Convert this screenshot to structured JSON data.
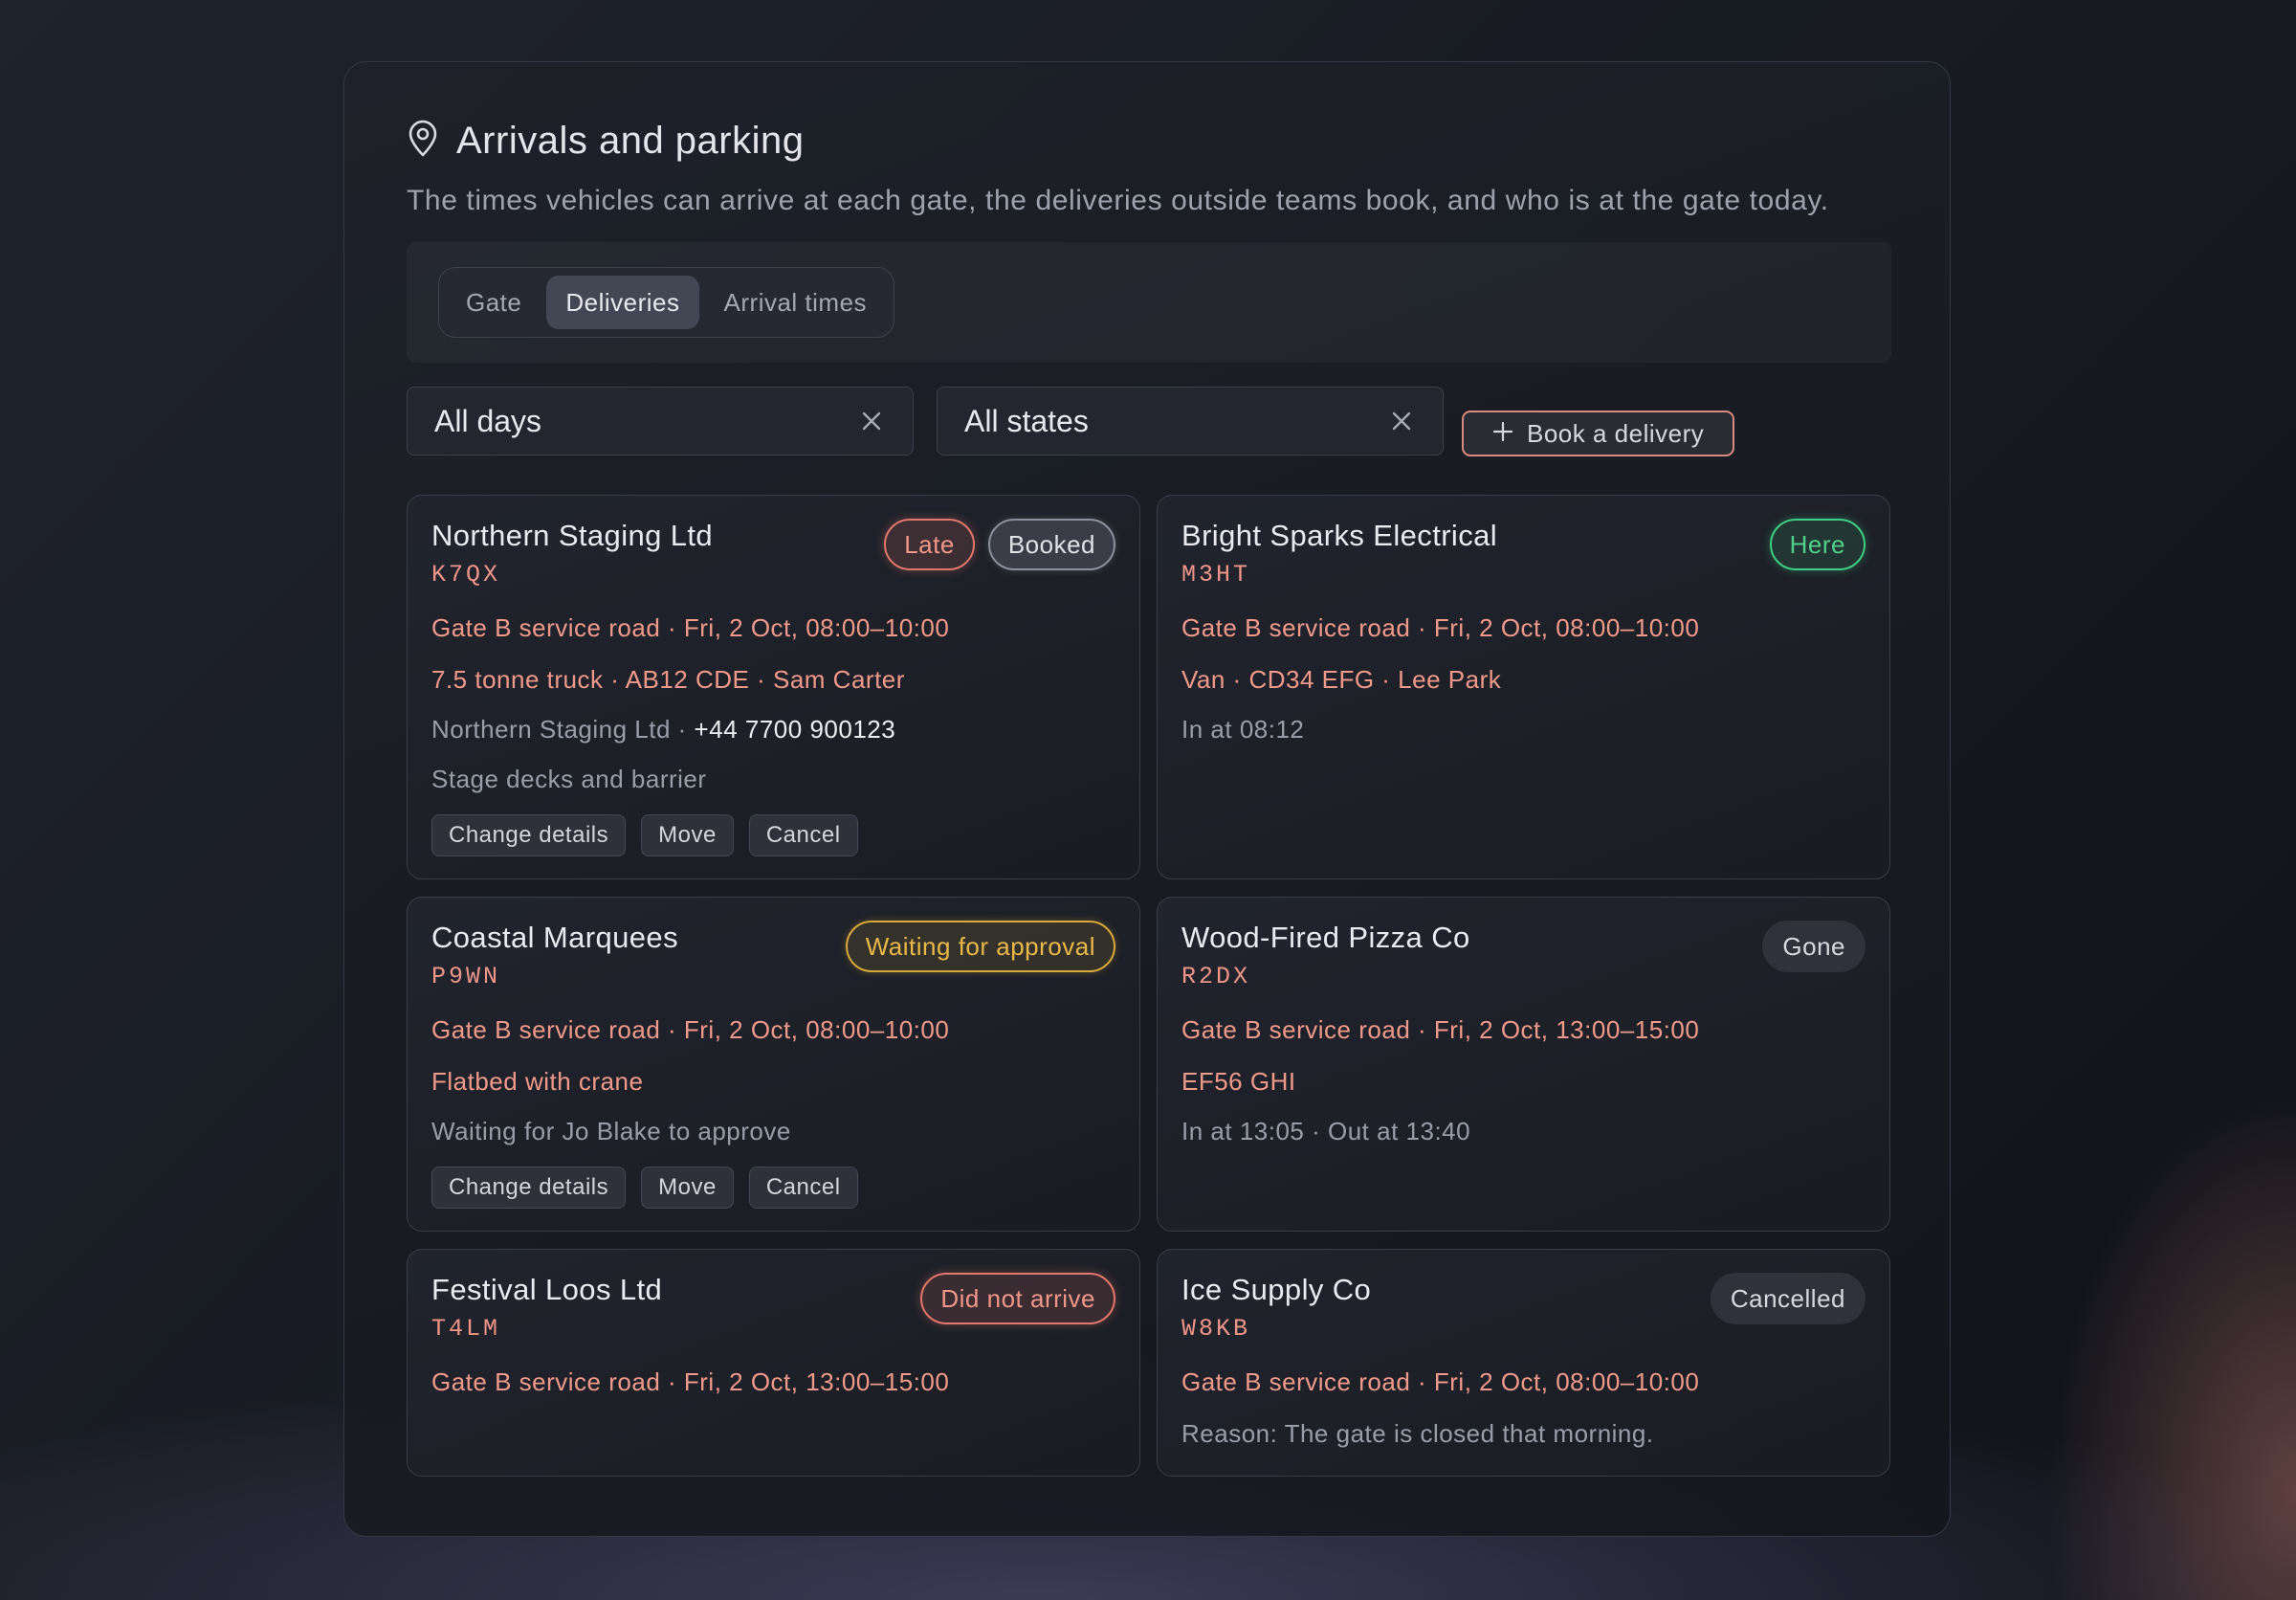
{
  "header": {
    "icon": "map-pin-icon",
    "title": "Arrivals and parking",
    "subtitle": "The times vehicles can arrive at each gate, the deliveries outside teams book, and who is at the gate today."
  },
  "tabs": [
    {
      "label": "Gate",
      "active": false
    },
    {
      "label": "Deliveries",
      "active": true
    },
    {
      "label": "Arrival times",
      "active": false
    }
  ],
  "filters": {
    "day": {
      "value": "All days",
      "clear_icon": "close-icon"
    },
    "state": {
      "value": "All states",
      "clear_icon": "close-icon"
    }
  },
  "book_button": {
    "label": "Book a delivery",
    "icon": "plus-icon"
  },
  "colors": {
    "accent": "#f19a8b",
    "late": "#e2776d",
    "here": "#3fcf86",
    "waiting": "#d9a93b"
  },
  "deliveries": [
    {
      "company": "Northern Staging Ltd",
      "code": "K7QX",
      "badges": [
        "Late",
        "Booked"
      ],
      "slot": "Gate B service road · Fri, 2 Oct, 08:00–10:00",
      "vehicle": "7.5 tonne truck · AB12 CDE · Sam Carter",
      "contact_prefix": "Northern Staging Ltd · ",
      "contact_phone": "+44 7700 900123",
      "note": "Stage decks and barrier",
      "actions": [
        "Change details",
        "Move",
        "Cancel"
      ]
    },
    {
      "company": "Bright Sparks Electrical",
      "code": "M3HT",
      "badges": [
        "Here"
      ],
      "slot": "Gate B service road · Fri, 2 Oct, 08:00–10:00",
      "vehicle": "Van · CD34 EFG · Lee Park",
      "note": "In at 08:12"
    },
    {
      "company": "Coastal Marquees",
      "code": "P9WN",
      "badges": [
        "Waiting for approval"
      ],
      "slot": "Gate B service road · Fri, 2 Oct, 08:00–10:00",
      "vehicle": "Flatbed with crane",
      "note": "Waiting for Jo Blake to approve",
      "actions": [
        "Change details",
        "Move",
        "Cancel"
      ]
    },
    {
      "company": "Wood-Fired Pizza Co",
      "code": "R2DX",
      "badges": [
        "Gone"
      ],
      "slot": "Gate B service road · Fri, 2 Oct, 13:00–15:00",
      "vehicle": "EF56 GHI",
      "note": "In at 13:05 · Out at 13:40"
    },
    {
      "company": "Festival Loos Ltd",
      "code": "T4LM",
      "badges": [
        "Did not arrive"
      ],
      "slot": "Gate B service road · Fri, 2 Oct, 13:00–15:00"
    },
    {
      "company": "Ice Supply Co",
      "code": "W8KB",
      "badges": [
        "Cancelled"
      ],
      "slot": "Gate B service road · Fri, 2 Oct, 08:00–10:00",
      "note": "Reason: The gate is closed that morning."
    }
  ]
}
